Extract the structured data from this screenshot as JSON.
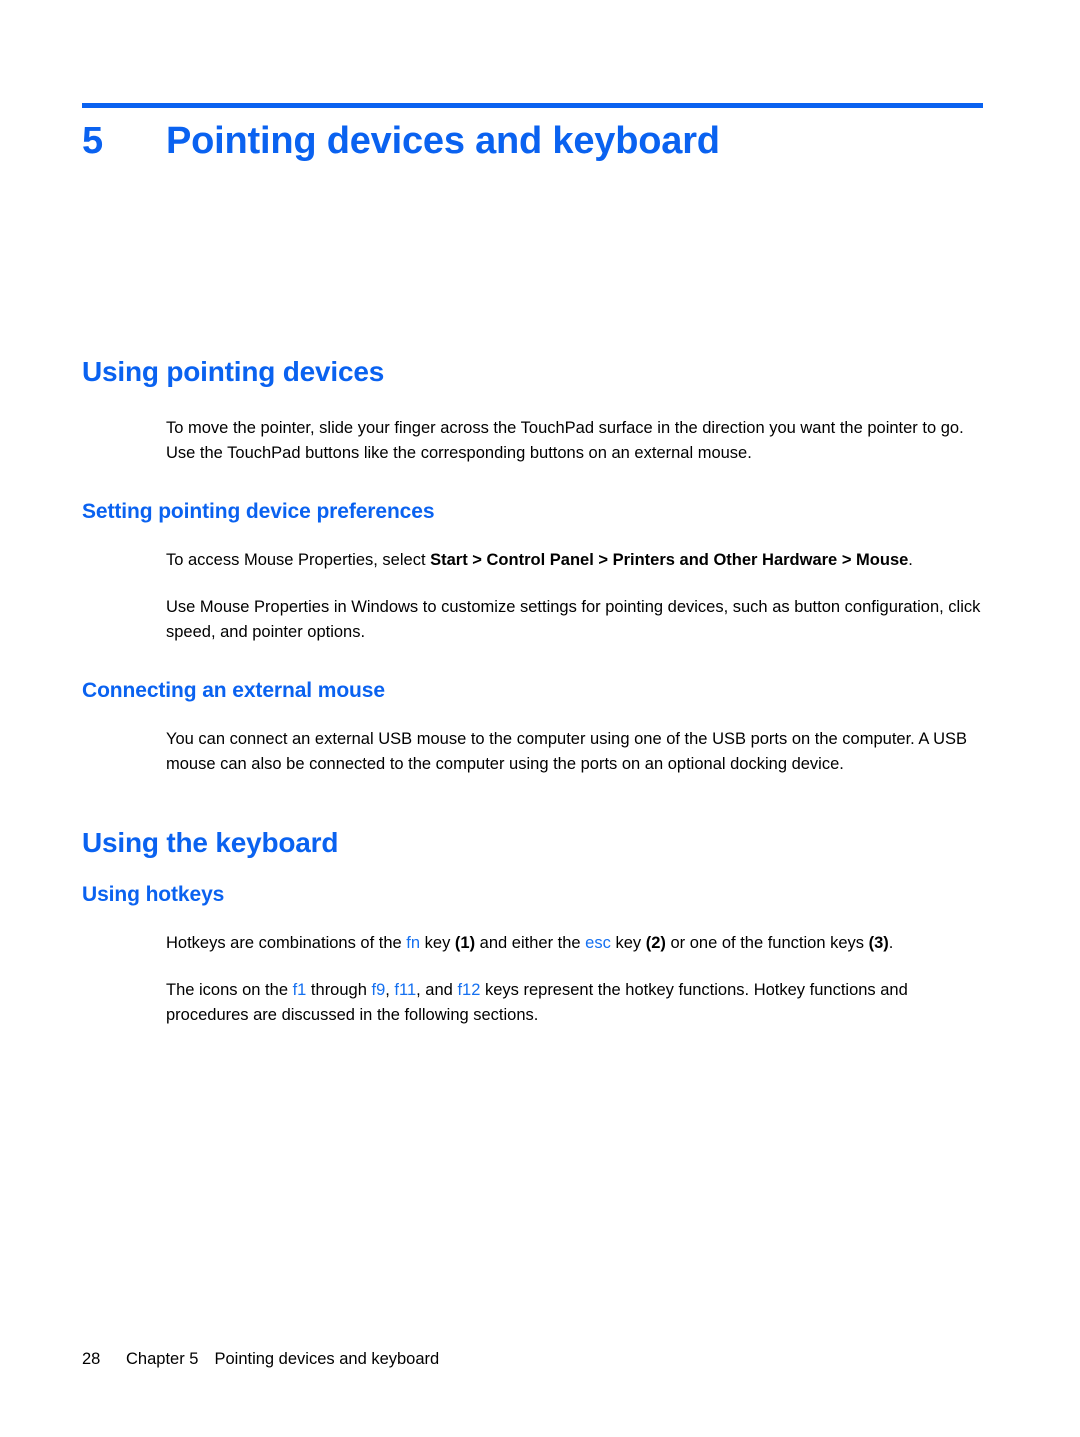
{
  "document": {
    "accent_color": "#0a62f0",
    "text_color": "#000000",
    "background_color": "#ffffff"
  },
  "chapter": {
    "number": "5",
    "title": "Pointing devices and keyboard"
  },
  "sections": {
    "using_pointing_devices": {
      "heading": "Using pointing devices",
      "intro": "To move the pointer, slide your finger across the TouchPad surface in the direction you want the pointer to go. Use the TouchPad buttons like the corresponding buttons on an external mouse.",
      "setting_preferences": {
        "heading": "Setting pointing device preferences",
        "para1_prefix": "To access Mouse Properties, select ",
        "para1_bold": "Start > Control Panel > Printers and Other Hardware > Mouse",
        "para1_suffix": ".",
        "para2": "Use Mouse Properties in Windows to customize settings for pointing devices, such as button configuration, click speed, and pointer options."
      },
      "connecting_mouse": {
        "heading": "Connecting an external mouse",
        "para1": "You can connect an external USB mouse to the computer using one of the USB ports on the computer. A USB mouse can also be connected to the computer using the ports on an optional docking device."
      }
    },
    "using_the_keyboard": {
      "heading": "Using the keyboard",
      "using_hotkeys": {
        "heading": "Using hotkeys",
        "para1": {
          "t1": "Hotkeys are combinations of the ",
          "k1": "fn",
          "t2": " key ",
          "b1": "(1)",
          "t3": " and either the ",
          "k2": "esc",
          "t4": " key ",
          "b2": "(2)",
          "t5": " or one of the function keys ",
          "b3": "(3)",
          "t6": "."
        },
        "para2": {
          "t1": "The icons on the ",
          "k1": "f1",
          "t2": " through ",
          "k2": "f9",
          "t3": ", ",
          "k3": "f11",
          "t4": ", and ",
          "k4": "f12",
          "t5": " keys represent the hotkey functions. Hotkey functions and procedures are discussed in the following sections."
        }
      }
    }
  },
  "footer": {
    "page_number": "28",
    "chapter_label": "Chapter 5",
    "chapter_title": "Pointing devices and keyboard"
  }
}
